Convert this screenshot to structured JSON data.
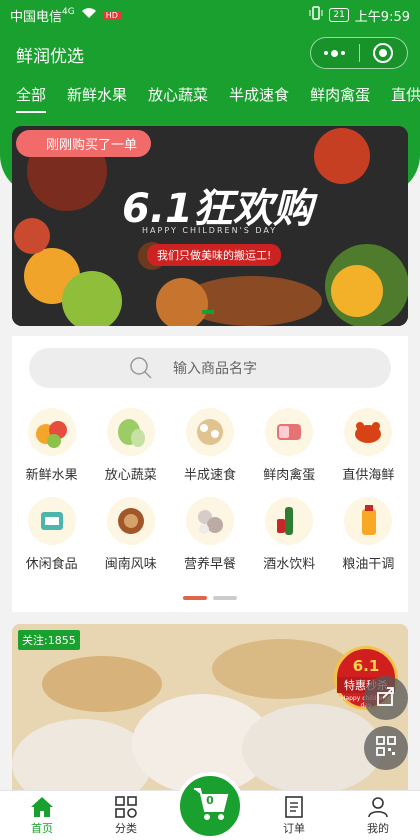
{
  "status": {
    "carrier": "中国电信",
    "network": "4G",
    "hd_badge": "HD",
    "battery": "21",
    "time": "上午9:59"
  },
  "header": {
    "title": "鲜润优选",
    "tabs": [
      "全部",
      "新鲜水果",
      "放心蔬菜",
      "半成速食",
      "鲜肉禽蛋",
      "直供"
    ]
  },
  "banner": {
    "toast": "刚刚购买了一单",
    "headline": "6.1狂欢购",
    "subline": "HAPPY CHILDREN'S DAY",
    "slogan": "我们只做美味的搬运工!"
  },
  "search": {
    "placeholder": "输入商品名字"
  },
  "categories": [
    {
      "label": "新鲜水果",
      "icon": "fruit-icon"
    },
    {
      "label": "放心蔬菜",
      "icon": "vegetable-icon"
    },
    {
      "label": "半成速食",
      "icon": "fast-food-icon"
    },
    {
      "label": "鲜肉禽蛋",
      "icon": "meat-icon"
    },
    {
      "label": "直供海鲜",
      "icon": "seafood-icon"
    },
    {
      "label": "休闲食品",
      "icon": "snack-icon"
    },
    {
      "label": "闽南风味",
      "icon": "local-food-icon"
    },
    {
      "label": "营养早餐",
      "icon": "breakfast-icon"
    },
    {
      "label": "酒水饮料",
      "icon": "drink-icon"
    },
    {
      "label": "粮油干调",
      "icon": "grain-oil-icon"
    }
  ],
  "product": {
    "follow": "关注:1855",
    "seal_top": "6.1",
    "seal_main": "特惠秒杀",
    "seal_sub": "Happy children's day"
  },
  "nav": {
    "home": "首页",
    "category": "分类",
    "cart_count": "0",
    "orders": "订单",
    "mine": "我的"
  },
  "colors": {
    "brand": "#1aa02e",
    "accent": "#e0664a"
  }
}
